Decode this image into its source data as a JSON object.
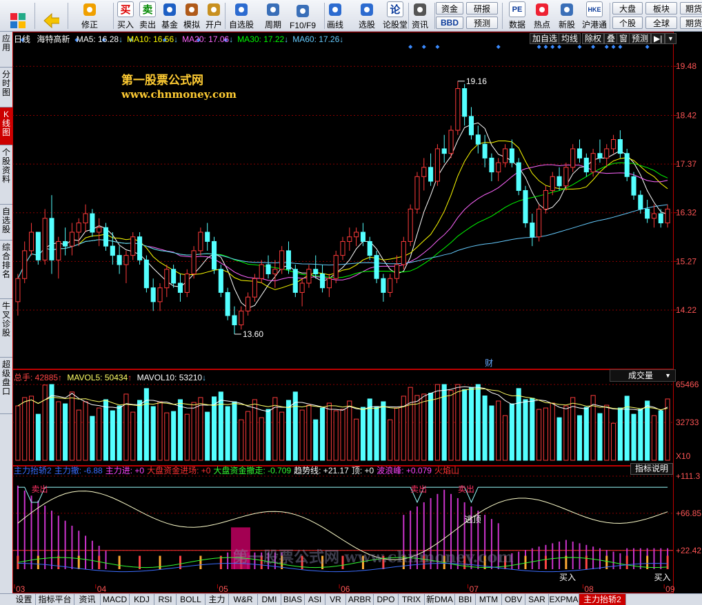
{
  "toolbar": {
    "buttons": [
      {
        "label": "",
        "icon": "grid-icon"
      },
      {
        "label": "",
        "icon": "back-arrow-icon"
      },
      {
        "label": "修正",
        "icon": "refresh-icon"
      },
      {
        "label": "买入",
        "icon": "buy-icon",
        "glyph": "买"
      },
      {
        "label": "卖出",
        "icon": "sell-icon",
        "glyph": "卖"
      },
      {
        "label": "基金",
        "icon": "fund-icon"
      },
      {
        "label": "模拟",
        "icon": "hammer-icon"
      },
      {
        "label": "开户",
        "icon": "lock-icon"
      },
      {
        "label": "自选股",
        "icon": "star-icon"
      },
      {
        "label": "周期",
        "icon": "clock-icon"
      },
      {
        "label": "F10/F9",
        "icon": "f10-icon"
      },
      {
        "label": "画线",
        "icon": "pen-icon"
      },
      {
        "label": "选股",
        "icon": "screen-icon"
      },
      {
        "label": "论股堂",
        "icon": "discuss-icon",
        "glyph": "论"
      },
      {
        "label": "资讯",
        "icon": "news-icon"
      },
      {
        "label": "数据",
        "icon": "pe-icon",
        "glyph": "PE"
      },
      {
        "label": "热点",
        "icon": "hot-icon"
      },
      {
        "label": "新股",
        "icon": "new-stock-icon"
      },
      {
        "label": "沪港通",
        "icon": "hk-connect-icon",
        "glyph": "HKE"
      }
    ],
    "mini": {
      "zijin": "资金",
      "bbd": "BBD",
      "yanbao": "研报",
      "yuce": "预测",
      "dapan": "大盘",
      "bankuai": "板块",
      "qihuo": "期货",
      "gegu": "个股",
      "quanqiu": "全球",
      "qiquan": "期货"
    }
  },
  "left_tabs": [
    "应用",
    "分时图",
    "K线图",
    "个股资料",
    "自选股",
    "综合排名",
    "牛叉诊股",
    "超级盘口"
  ],
  "bottom_tabs": [
    "设置",
    "指标平台",
    "资讯",
    "MACD",
    "KDJ",
    "RSI",
    "BOLL",
    "主力",
    "W&R",
    "DMI",
    "BIAS",
    "ASI",
    "VR",
    "ARBR",
    "DPO",
    "TRIX",
    "新DMA",
    "BBI",
    "MTM",
    "OBV",
    "SAR",
    "EXPMA",
    "主力抬轿2"
  ],
  "kline": {
    "period": "日线",
    "name": "海特高新",
    "ma": [
      {
        "label": "MA5: 16.28",
        "color": "#ffffff"
      },
      {
        "label": "MA10: 16.56",
        "color": "#ffff00"
      },
      {
        "label": "MA20: 17.06",
        "color": "#ff66ff"
      },
      {
        "label": "MA30: 17.22",
        "color": "#00ff00"
      },
      {
        "label": "MA60: 17.26",
        "color": "#66ccff"
      }
    ],
    "buttons": [
      "加自选",
      "均线",
      "除权",
      "叠",
      "窗",
      "预测"
    ],
    "watermark_title": "第一股票公式网",
    "watermark_url": "www.chnmoney.com",
    "high_label": "19.16",
    "low_label": "13.60",
    "cai_marker": "财",
    "y_ticks": [
      "19.48",
      "18.42",
      "17.37",
      "16.32",
      "15.27",
      "14.22"
    ]
  },
  "volume": {
    "label_total": "总手: 42885",
    "label_mavol5": "MAVOL5: 50434",
    "label_mavol10": "MAVOL10: 53210",
    "dropdown": "成交量",
    "y_ticks": [
      "65466",
      "32733",
      "X10"
    ]
  },
  "indicator": {
    "items": [
      {
        "text": "主力抬轿2",
        "color": "#3b6dff"
      },
      {
        "text": "主力撤: -6.88",
        "color": "#3b6dff"
      },
      {
        "text": "主力进: +0",
        "color": "#ff44ff"
      },
      {
        "text": "大盘资金进场: +0",
        "color": "#ff3333"
      },
      {
        "text": "大盘资金撤走: -0.709",
        "color": "#33ff33"
      },
      {
        "text": "趋势线: +21.17",
        "color": "#ffffff"
      },
      {
        "text": "顶: +0",
        "color": "#ffffff"
      },
      {
        "text": "波浪峰: +0.079",
        "color": "#ff44ff"
      },
      {
        "text": "火焰山",
        "color": "#ff3333"
      }
    ],
    "explain_button": "指标说明",
    "y_ticks": [
      "+111.3",
      "+66.85",
      "+22.42"
    ],
    "sell_labels": [
      "卖出",
      "卖出",
      "卖出"
    ],
    "top_label": "逃顶",
    "buy_labels": [
      "买入",
      "买入"
    ],
    "watermark": "第一股票公式网 www.chnmoney.com"
  },
  "x_ticks": [
    "03",
    "04",
    "05",
    "06",
    "07",
    "08",
    "09"
  ],
  "colors": {
    "up": "#ff3b3b",
    "down": "#54ffff",
    "grid": "#8b0000",
    "axis": "#c00000"
  },
  "chart_data": {
    "type": "candlestick",
    "title": "海特高新",
    "ylim": [
      13.0,
      19.9
    ],
    "candles": [
      [
        14.4,
        15.0,
        14.1,
        14.9
      ],
      [
        14.9,
        15.7,
        14.8,
        15.5
      ],
      [
        15.5,
        16.1,
        15.4,
        15.9
      ],
      [
        15.9,
        15.8,
        15.2,
        15.3
      ],
      [
        15.3,
        16.4,
        15.2,
        16.2
      ],
      [
        16.2,
        16.7,
        15.0,
        15.3
      ],
      [
        15.3,
        15.8,
        14.9,
        15.7
      ],
      [
        15.7,
        16.0,
        15.4,
        15.6
      ],
      [
        15.6,
        16.1,
        15.4,
        15.9
      ],
      [
        15.9,
        16.2,
        15.6,
        16.1
      ],
      [
        16.1,
        16.5,
        15.9,
        16.3
      ],
      [
        16.3,
        16.4,
        15.8,
        15.9
      ],
      [
        15.9,
        16.2,
        15.6,
        16.0
      ],
      [
        16.0,
        16.1,
        15.5,
        15.6
      ],
      [
        15.6,
        15.9,
        15.2,
        15.4
      ],
      [
        15.4,
        15.6,
        15.0,
        15.2
      ],
      [
        15.2,
        15.5,
        14.8,
        15.4
      ],
      [
        15.4,
        15.9,
        15.3,
        15.8
      ],
      [
        15.8,
        15.9,
        15.2,
        15.3
      ],
      [
        15.3,
        15.4,
        14.6,
        14.7
      ],
      [
        14.7,
        14.9,
        14.2,
        14.4
      ],
      [
        14.4,
        14.8,
        14.2,
        14.7
      ],
      [
        14.7,
        15.2,
        14.5,
        15.1
      ],
      [
        15.1,
        15.2,
        14.7,
        14.8
      ],
      [
        14.8,
        15.0,
        14.4,
        14.6
      ],
      [
        14.6,
        15.1,
        14.5,
        15.0
      ],
      [
        15.0,
        15.6,
        14.9,
        15.5
      ],
      [
        15.5,
        16.0,
        15.4,
        15.9
      ],
      [
        15.9,
        16.1,
        15.5,
        15.7
      ],
      [
        15.7,
        15.8,
        15.0,
        15.1
      ],
      [
        15.1,
        15.2,
        14.5,
        14.6
      ],
      [
        14.6,
        14.7,
        14.0,
        14.1
      ],
      [
        14.1,
        14.3,
        13.7,
        13.9
      ],
      [
        13.9,
        14.3,
        13.8,
        14.2
      ],
      [
        14.2,
        14.6,
        14.1,
        14.5
      ],
      [
        14.5,
        15.0,
        14.4,
        14.9
      ],
      [
        14.9,
        15.3,
        14.8,
        15.2
      ],
      [
        15.2,
        15.4,
        14.9,
        15.0
      ],
      [
        15.0,
        15.3,
        14.7,
        15.1
      ],
      [
        15.1,
        15.6,
        15.0,
        15.5
      ],
      [
        15.5,
        15.7,
        15.0,
        15.1
      ],
      [
        15.1,
        15.2,
        14.5,
        14.6
      ],
      [
        14.6,
        14.9,
        14.3,
        14.8
      ],
      [
        14.8,
        15.2,
        14.7,
        15.1
      ],
      [
        15.1,
        15.4,
        14.9,
        15.0
      ],
      [
        15.0,
        15.2,
        14.6,
        14.7
      ],
      [
        14.7,
        15.0,
        14.5,
        14.9
      ],
      [
        14.9,
        15.5,
        14.8,
        15.4
      ],
      [
        15.4,
        15.8,
        15.3,
        15.7
      ],
      [
        15.7,
        16.0,
        15.5,
        15.8
      ],
      [
        15.8,
        16.0,
        15.6,
        15.9
      ],
      [
        15.9,
        16.1,
        15.6,
        15.7
      ],
      [
        15.7,
        15.8,
        15.3,
        15.4
      ],
      [
        15.4,
        15.5,
        14.8,
        14.9
      ],
      [
        14.9,
        15.0,
        14.4,
        14.6
      ],
      [
        14.6,
        15.0,
        14.5,
        14.9
      ],
      [
        14.9,
        15.4,
        14.8,
        15.2
      ],
      [
        15.2,
        15.8,
        15.1,
        15.7
      ],
      [
        15.7,
        16.5,
        15.6,
        16.4
      ],
      [
        16.4,
        17.2,
        16.3,
        17.1
      ],
      [
        17.1,
        17.5,
        16.8,
        17.3
      ],
      [
        17.3,
        17.6,
        16.9,
        17.0
      ],
      [
        17.0,
        17.8,
        16.9,
        17.7
      ],
      [
        17.7,
        18.0,
        17.4,
        17.6
      ],
      [
        17.6,
        18.2,
        17.5,
        18.1
      ],
      [
        18.1,
        19.16,
        18.0,
        19.0
      ],
      [
        19.0,
        19.1,
        18.2,
        18.4
      ],
      [
        18.4,
        18.6,
        17.9,
        18.0
      ],
      [
        18.0,
        18.2,
        17.6,
        17.8
      ],
      [
        17.8,
        18.0,
        17.3,
        17.5
      ],
      [
        17.5,
        17.6,
        17.0,
        17.2
      ],
      [
        17.2,
        17.5,
        17.0,
        17.4
      ],
      [
        17.4,
        17.8,
        17.3,
        17.7
      ],
      [
        17.7,
        17.9,
        17.3,
        17.4
      ],
      [
        17.4,
        17.5,
        16.7,
        16.8
      ],
      [
        16.8,
        16.9,
        16.0,
        16.1
      ],
      [
        16.1,
        16.3,
        15.6,
        15.8
      ],
      [
        15.8,
        16.5,
        15.7,
        16.4
      ],
      [
        16.4,
        16.9,
        16.3,
        16.8
      ],
      [
        16.8,
        17.2,
        16.7,
        17.1
      ],
      [
        17.1,
        17.3,
        16.8,
        16.9
      ],
      [
        16.9,
        17.4,
        16.8,
        17.3
      ],
      [
        17.3,
        17.8,
        17.2,
        17.7
      ],
      [
        17.7,
        17.9,
        17.4,
        17.5
      ],
      [
        17.5,
        17.6,
        17.1,
        17.2
      ],
      [
        17.2,
        17.7,
        17.1,
        17.6
      ],
      [
        17.6,
        17.9,
        17.4,
        17.5
      ],
      [
        17.5,
        17.8,
        17.3,
        17.7
      ],
      [
        17.7,
        18.0,
        17.6,
        17.9
      ],
      [
        17.9,
        18.1,
        17.5,
        17.6
      ],
      [
        17.6,
        17.7,
        17.0,
        17.1
      ],
      [
        17.1,
        17.2,
        16.6,
        16.7
      ],
      [
        16.7,
        16.8,
        16.3,
        16.4
      ],
      [
        16.4,
        16.6,
        16.1,
        16.2
      ],
      [
        16.2,
        16.5,
        16.0,
        16.3
      ],
      [
        16.3,
        16.4,
        16.0,
        16.1
      ],
      [
        16.1,
        16.5,
        16.0,
        16.4
      ]
    ]
  }
}
